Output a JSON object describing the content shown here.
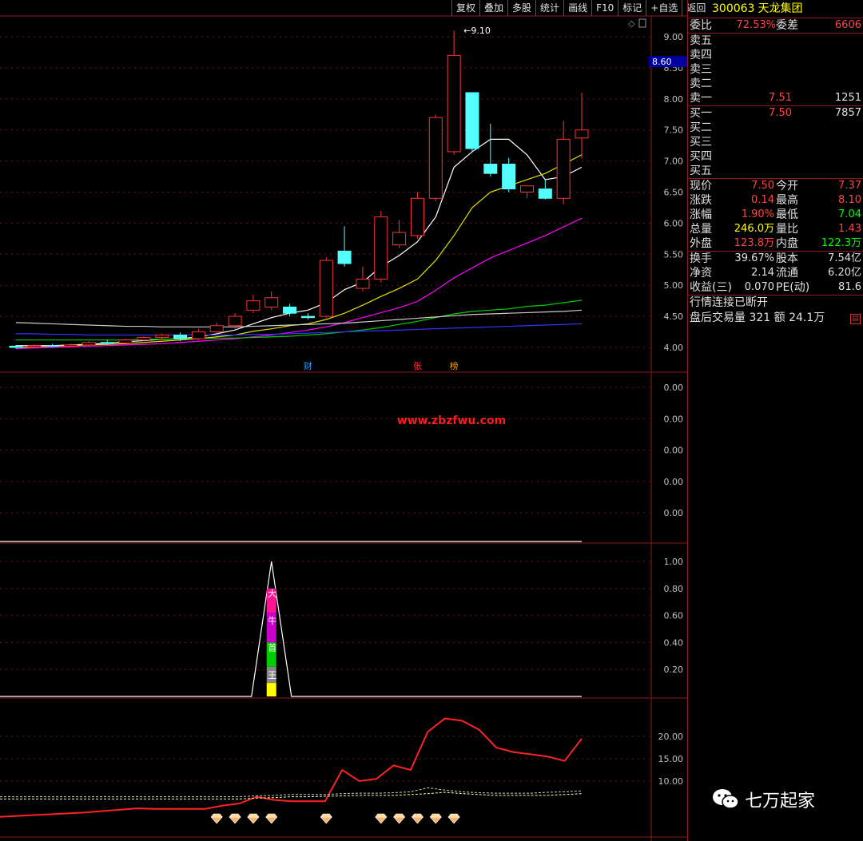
{
  "toolbar": [
    "复权",
    "叠加",
    "多股",
    "统计",
    "画线",
    "F10",
    "标记",
    "+自选",
    "返回"
  ],
  "chart_data": [
    {
      "type": "candlestick",
      "panel": "price",
      "ylim": [
        3.9,
        9.3
      ],
      "y_ticks": [
        "9.00",
        "8.50",
        "8.00",
        "7.50",
        "7.00",
        "6.50",
        "6.00",
        "5.50",
        "5.00",
        "4.50",
        "4.00"
      ],
      "current_price_label": "8.60",
      "high_label": "9.10",
      "candles": [
        {
          "o": 4.02,
          "h": 4.04,
          "c": 4.0,
          "l": 3.98
        },
        {
          "o": 4.01,
          "h": 4.05,
          "c": 4.03,
          "l": 3.99
        },
        {
          "o": 4.03,
          "h": 4.06,
          "c": 4.02,
          "l": 4.0
        },
        {
          "o": 4.02,
          "h": 4.06,
          "c": 4.04,
          "l": 4.0
        },
        {
          "o": 4.04,
          "h": 4.1,
          "c": 4.08,
          "l": 4.02
        },
        {
          "o": 4.08,
          "h": 4.12,
          "c": 4.07,
          "l": 4.04
        },
        {
          "o": 4.07,
          "h": 4.14,
          "c": 4.12,
          "l": 4.06
        },
        {
          "o": 4.12,
          "h": 4.18,
          "c": 4.16,
          "l": 4.1
        },
        {
          "o": 4.16,
          "h": 4.22,
          "c": 4.2,
          "l": 4.12
        },
        {
          "o": 4.2,
          "h": 4.24,
          "c": 4.14,
          "l": 4.1
        },
        {
          "o": 4.14,
          "h": 4.3,
          "c": 4.25,
          "l": 4.12
        },
        {
          "o": 4.25,
          "h": 4.4,
          "c": 4.35,
          "l": 4.2
        },
        {
          "o": 4.35,
          "h": 4.55,
          "c": 4.5,
          "l": 4.3
        },
        {
          "o": 4.6,
          "h": 4.85,
          "c": 4.75,
          "l": 4.55
        },
        {
          "o": 4.65,
          "h": 4.9,
          "c": 4.8,
          "l": 4.6
        },
        {
          "o": 4.65,
          "h": 4.7,
          "c": 4.55,
          "l": 4.5
        },
        {
          "o": 4.5,
          "h": 4.55,
          "c": 4.48,
          "l": 4.45
        },
        {
          "o": 4.5,
          "h": 5.45,
          "c": 5.4,
          "l": 4.48
        },
        {
          "o": 5.55,
          "h": 5.95,
          "c": 5.35,
          "l": 5.3
        },
        {
          "o": 4.95,
          "h": 5.3,
          "c": 5.1,
          "l": 4.9
        },
        {
          "o": 5.1,
          "h": 6.2,
          "c": 6.1,
          "l": 5.05
        },
        {
          "o": 5.65,
          "h": 6.05,
          "c": 5.85,
          "l": 5.6
        },
        {
          "o": 5.8,
          "h": 6.5,
          "c": 6.4,
          "l": 5.75
        },
        {
          "o": 6.4,
          "h": 7.75,
          "c": 7.7,
          "l": 6.35
        },
        {
          "o": 7.15,
          "h": 9.1,
          "c": 8.7,
          "l": 7.1
        },
        {
          "o": 8.1,
          "h": 8.1,
          "c": 7.2,
          "l": 7.15
        },
        {
          "o": 6.95,
          "h": 7.6,
          "c": 6.8,
          "l": 6.75
        },
        {
          "o": 6.95,
          "h": 7.05,
          "c": 6.55,
          "l": 6.5
        },
        {
          "o": 6.5,
          "h": 6.6,
          "c": 6.6,
          "l": 6.4
        },
        {
          "o": 6.55,
          "h": 6.7,
          "c": 6.4,
          "l": 6.38
        },
        {
          "o": 6.4,
          "h": 7.65,
          "c": 7.35,
          "l": 6.3
        },
        {
          "o": 7.37,
          "h": 8.1,
          "c": 7.5,
          "l": 7.04
        }
      ],
      "series": [
        {
          "color": "#ffffff",
          "values": [
            4.03,
            4.03,
            4.03,
            4.04,
            4.05,
            4.07,
            4.09,
            4.11,
            4.13,
            4.14,
            4.17,
            4.22,
            4.28,
            4.38,
            4.48,
            4.55,
            4.6,
            4.72,
            4.93,
            5.05,
            5.3,
            5.48,
            5.7,
            6.1,
            6.9,
            7.15,
            7.35,
            7.35,
            7.1,
            6.7,
            6.75,
            6.9
          ]
        },
        {
          "color": "#e0e000",
          "values": [
            4.0,
            4.01,
            4.02,
            4.03,
            4.04,
            4.05,
            4.06,
            4.08,
            4.1,
            4.12,
            4.14,
            4.17,
            4.2,
            4.26,
            4.3,
            4.35,
            4.38,
            4.45,
            4.55,
            4.68,
            4.82,
            4.95,
            5.1,
            5.4,
            5.8,
            6.25,
            6.5,
            6.6,
            6.7,
            6.8,
            6.95,
            7.1
          ]
        },
        {
          "color": "#ff00ff",
          "values": [
            3.98,
            3.99,
            4.0,
            4.01,
            4.02,
            4.03,
            4.04,
            4.05,
            4.06,
            4.08,
            4.1,
            4.12,
            4.14,
            4.17,
            4.2,
            4.24,
            4.28,
            4.33,
            4.4,
            4.48,
            4.56,
            4.64,
            4.74,
            4.92,
            5.12,
            5.28,
            5.44,
            5.56,
            5.68,
            5.8,
            5.94,
            6.08
          ]
        },
        {
          "color": "#00cc00",
          "values": [
            4.12,
            4.12,
            4.12,
            4.12,
            4.12,
            4.12,
            4.12,
            4.13,
            4.13,
            4.14,
            4.14,
            4.15,
            4.15,
            4.16,
            4.17,
            4.18,
            4.2,
            4.22,
            4.25,
            4.28,
            4.32,
            4.37,
            4.42,
            4.48,
            4.54,
            4.58,
            4.6,
            4.62,
            4.66,
            4.68,
            4.72,
            4.76
          ]
        },
        {
          "color": "#cccccc",
          "values": [
            4.4,
            4.39,
            4.38,
            4.37,
            4.36,
            4.35,
            4.34,
            4.34,
            4.33,
            4.33,
            4.33,
            4.33,
            4.33,
            4.34,
            4.35,
            4.36,
            4.37,
            4.38,
            4.39,
            4.41,
            4.43,
            4.45,
            4.47,
            4.49,
            4.51,
            4.53,
            4.54,
            4.55,
            4.56,
            4.57,
            4.58,
            4.6
          ]
        },
        {
          "color": "#3333ff",
          "values": [
            4.22,
            4.22,
            4.21,
            4.21,
            4.2,
            4.2,
            4.2,
            4.2,
            4.2,
            4.2,
            4.2,
            4.2,
            4.2,
            4.21,
            4.21,
            4.22,
            4.23,
            4.24,
            4.25,
            4.26,
            4.27,
            4.28,
            4.29,
            4.3,
            4.31,
            4.32,
            4.33,
            4.34,
            4.35,
            4.36,
            4.37,
            4.38
          ]
        }
      ],
      "markers": [
        {
          "index": 16,
          "text": "财",
          "color": "#3399ff"
        },
        {
          "index": 22,
          "text": "张",
          "color": "#ff3333"
        },
        {
          "index": 24,
          "text": "榜",
          "color": "#ff9900"
        }
      ]
    },
    {
      "type": "line",
      "panel": "indicator1",
      "y_ticks": [
        "0.00",
        "0.00",
        "0.00",
        "0.00",
        "0.00"
      ],
      "watermark": "www.zbzfwu.com"
    },
    {
      "type": "bar",
      "panel": "indicator2",
      "ylim": [
        0,
        1.0
      ],
      "y_ticks": [
        "1.00",
        "0.80",
        "0.60",
        "0.40",
        "0.20"
      ],
      "spike_index": 14,
      "bar_labels": [
        "大",
        "牛",
        "首",
        "王"
      ]
    },
    {
      "type": "line",
      "panel": "indicator3",
      "ylim": [
        0,
        30
      ],
      "y_ticks": [
        "20.00",
        "15.00",
        "10.00"
      ],
      "series": [
        {
          "color": "#ff2222",
          "values": [
            2.0,
            2.2,
            2.4,
            2.6,
            2.8,
            3.0,
            3.3,
            3.6,
            3.9,
            3.8,
            3.8,
            3.8,
            3.8,
            4.5,
            5.0,
            6.5,
            5.8,
            5.5,
            5.5,
            5.5,
            12.5,
            10.0,
            10.5,
            13.5,
            12.5,
            21.0,
            24.0,
            23.5,
            21.5,
            17.5,
            16.5,
            16.0,
            15.5,
            14.5,
            19.5
          ]
        },
        {
          "color": "#ffff99",
          "values": [
            6.0,
            6.0,
            6.0,
            6.0,
            6.0,
            6.0,
            6.0,
            6.0,
            6.0,
            6.0,
            6.0,
            6.0,
            6.0,
            6.0,
            6.0,
            6.2,
            6.3,
            6.5,
            6.5,
            6.6,
            6.7,
            6.8,
            6.8,
            6.8,
            7.0,
            7.2,
            7.5,
            7.2,
            7.0,
            6.8,
            6.8,
            6.8,
            6.8,
            7.0,
            7.2
          ]
        },
        {
          "color": "#cccccc",
          "values": [
            6.5,
            6.5,
            6.5,
            6.5,
            6.5,
            6.5,
            6.5,
            6.5,
            6.5,
            6.5,
            6.5,
            6.5,
            6.5,
            6.5,
            6.5,
            6.7,
            6.8,
            7.0,
            7.0,
            7.0,
            7.2,
            7.3,
            7.3,
            7.4,
            7.6,
            8.5,
            8.0,
            7.6,
            7.4,
            7.3,
            7.3,
            7.3,
            7.5,
            7.6,
            7.8
          ]
        }
      ],
      "diamond_indices": [
        11,
        12,
        13,
        14,
        17,
        20,
        21,
        22,
        23,
        24
      ]
    }
  ],
  "panel": {
    "code": "300063",
    "name": "天龙集团",
    "weibi": {
      "label": "委比",
      "value": "72.53%",
      "label2": "委差",
      "value2": "6606"
    },
    "sells": [
      {
        "label": "卖五",
        "price": "",
        "vol": ""
      },
      {
        "label": "卖四",
        "price": "",
        "vol": ""
      },
      {
        "label": "卖三",
        "price": "",
        "vol": ""
      },
      {
        "label": "卖二",
        "price": "",
        "vol": ""
      },
      {
        "label": "卖一",
        "price": "7.51",
        "vol": "1251"
      }
    ],
    "buys": [
      {
        "label": "买一",
        "price": "7.50",
        "vol": "7857"
      },
      {
        "label": "买二",
        "price": "",
        "vol": ""
      },
      {
        "label": "买三",
        "price": "",
        "vol": ""
      },
      {
        "label": "买四",
        "price": "",
        "vol": ""
      },
      {
        "label": "买五",
        "price": "",
        "vol": ""
      }
    ],
    "quote": [
      {
        "l1": "现价",
        "v1": "7.50",
        "c1": "red",
        "l2": "今开",
        "v2": "7.37",
        "c2": "red"
      },
      {
        "l1": "涨跌",
        "v1": "0.14",
        "c1": "red",
        "l2": "最高",
        "v2": "8.10",
        "c2": "red"
      },
      {
        "l1": "涨幅",
        "v1": "1.90%",
        "c1": "red",
        "l2": "最低",
        "v2": "7.04",
        "c2": "grn"
      },
      {
        "l1": "总量",
        "v1": "246.0万",
        "c1": "yel",
        "l2": "量比",
        "v2": "1.43",
        "c2": "red"
      },
      {
        "l1": "外盘",
        "v1": "123.8万",
        "c1": "red",
        "l2": "内盘",
        "v2": "122.3万",
        "c2": "grn"
      }
    ],
    "fund": [
      {
        "l1": "换手",
        "v1": "39.67%",
        "l2": "股本",
        "v2": "7.54亿"
      },
      {
        "l1": "净资",
        "v1": "2.14",
        "l2": "流通",
        "v2": "6.20亿"
      },
      {
        "l1": "收益(三)",
        "v1": "0.070",
        "l2": "PE(动)",
        "v2": "81.6"
      }
    ],
    "status": "行情连接已断开",
    "after_hours": "盘后交易量 321 额 24.1万"
  },
  "brand": {
    "text": "七万起家",
    "icon": "wechat-icon"
  }
}
